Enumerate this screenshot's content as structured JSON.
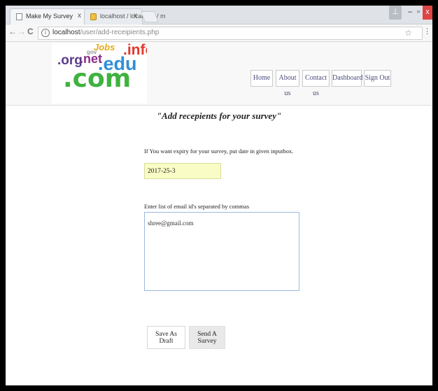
{
  "browser": {
    "tabs": [
      {
        "title": "Make My Survey",
        "close": "x"
      },
      {
        "title": "localhost / localhost / m",
        "close": "x"
      }
    ],
    "window_controls": {
      "user": "⊥",
      "minimize": "–",
      "maximize": "▫",
      "close": "x"
    },
    "url": {
      "host": "localhost",
      "path": "/user/add-receipients.php"
    },
    "back": "←",
    "forward": "→",
    "reload": "C",
    "star": "☆",
    "menu": "⋮"
  },
  "header": {
    "logo": {
      "org": ".org",
      "net": ".net",
      "jobs": "Jobs",
      "edu": ".edu",
      "info": ".info",
      "com": ".com",
      "gov": "gov"
    },
    "nav": {
      "home": "Home",
      "about": "About us",
      "contact": "Contact us",
      "dashboard": "Dashboard",
      "signout": "Sign Out"
    }
  },
  "main": {
    "title": "\"Add recepients for your survey\"",
    "expiry_label": "If You want expiry for your survey, put date in given inputbox.",
    "expiry_value": "2017-25-3",
    "emails_label": "Enter list of email id's separated by commas",
    "emails_value": "shree@gmail.com",
    "save_draft_label": "Save As Draft",
    "send_label": "Send A Survey"
  }
}
